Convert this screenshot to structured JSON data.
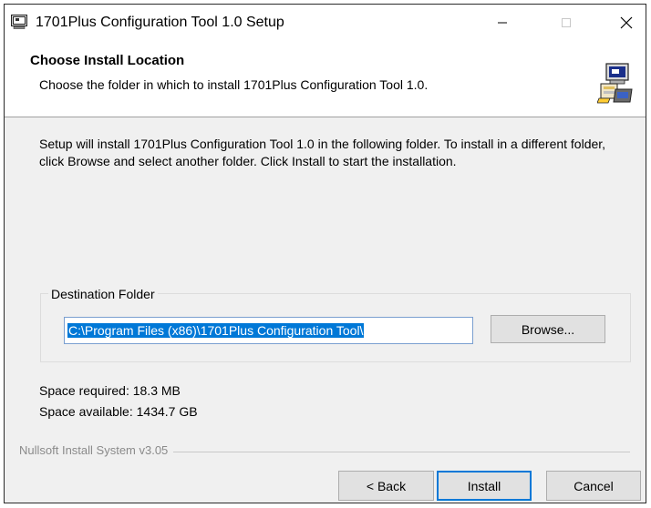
{
  "window": {
    "title": "1701Plus Configuration Tool 1.0 Setup",
    "controls": {
      "minimize_icon": "minimize-icon",
      "maximize_icon": "maximize-icon",
      "close_icon": "close-icon"
    }
  },
  "header": {
    "title": "Choose Install Location",
    "subtitle": "Choose the folder in which to install 1701Plus Configuration Tool 1.0.",
    "icon": "installer-computer-icon"
  },
  "body": {
    "description": "Setup will install 1701Plus Configuration Tool 1.0 in the following folder. To install in a different folder, click Browse and select another folder. Click Install to start the installation."
  },
  "destination": {
    "group_label": "Destination Folder",
    "path_value": "C:\\Program Files (x86)\\1701Plus Configuration Tool\\",
    "browse_label": "Browse..."
  },
  "space": {
    "required": "Space required: 18.3 MB",
    "available": "Space available: 1434.7 GB"
  },
  "footer": {
    "brand": "Nullsoft Install System v3.05",
    "back_label": "< Back",
    "install_label": "Install",
    "cancel_label": "Cancel"
  },
  "colors": {
    "selection": "#0078d7",
    "window_bg": "#f0f0f0",
    "default_button_border": "#0078d7"
  }
}
